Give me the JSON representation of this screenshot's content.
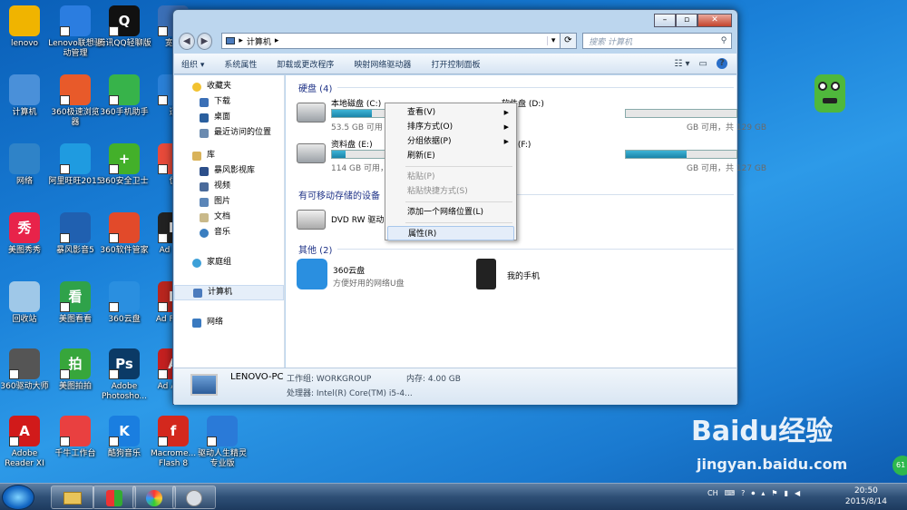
{
  "desktop_icons": [
    {
      "label": "lenovo",
      "color": "#f0b400",
      "glyph": ""
    },
    {
      "label": "Lenovo联想驱动管理",
      "color": "#2b7de0",
      "glyph": ""
    },
    {
      "label": "腾讯QQ轻聊版",
      "color": "#111111",
      "glyph": "Q"
    },
    {
      "label": "宽带",
      "color": "#3b6fb6",
      "glyph": ""
    },
    {
      "label": "计算机",
      "color": "#4a90d9",
      "glyph": ""
    },
    {
      "label": "360极速浏览器",
      "color": "#e85a2a",
      "glyph": ""
    },
    {
      "label": "360手机助手",
      "color": "#37b34a",
      "glyph": ""
    },
    {
      "label": "迅",
      "color": "#2a7fd6",
      "glyph": ""
    },
    {
      "label": "网络",
      "color": "#2f83c8",
      "glyph": ""
    },
    {
      "label": "阿里旺旺2015",
      "color": "#1f9be0",
      "glyph": ""
    },
    {
      "label": "360安全卫士",
      "color": "#43b02a",
      "glyph": "+"
    },
    {
      "label": "优",
      "color": "#e84a3a",
      "glyph": ""
    },
    {
      "label": "美图秀秀",
      "color": "#e8234a",
      "glyph": "秀"
    },
    {
      "label": "暴风影音5",
      "color": "#2060b0",
      "glyph": ""
    },
    {
      "label": "360软件管家",
      "color": "#e24a2a",
      "glyph": ""
    },
    {
      "label": "Ad Fire",
      "color": "#222222",
      "glyph": "F"
    },
    {
      "label": "回收站",
      "color": "#9fc8e8",
      "glyph": ""
    },
    {
      "label": "美图看看",
      "color": "#2fa24a",
      "glyph": "看"
    },
    {
      "label": "360云盘",
      "color": "#2a8fe0",
      "glyph": ""
    },
    {
      "label": "Ad Flash",
      "color": "#b8261e",
      "glyph": "F"
    },
    {
      "label": "360驱动大师",
      "color": "#555555",
      "glyph": ""
    },
    {
      "label": "美图拍拍",
      "color": "#37a63b",
      "glyph": "拍"
    },
    {
      "label": "Adobe Photosho...",
      "color": "#0b3a66",
      "glyph": "Ps"
    },
    {
      "label": "Ad Appl",
      "color": "#c42020",
      "glyph": "A"
    },
    {
      "label": "Adobe Reader XI",
      "color": "#d11a1a",
      "glyph": "A"
    },
    {
      "label": "千牛工作台",
      "color": "#e94040",
      "glyph": ""
    },
    {
      "label": "酷狗音乐",
      "color": "#1a7ee0",
      "glyph": "K"
    },
    {
      "label": "Macrome... Flash 8",
      "color": "#d3281d",
      "glyph": "f"
    },
    {
      "label": "驱动人生精灵 专业版",
      "color": "#2a7ad8",
      "glyph": ""
    }
  ],
  "window": {
    "breadcrumb": "计算机",
    "search_placeholder": "搜索 计算机",
    "toolbar": [
      "组织 ▾",
      "系统属性",
      "卸载或更改程序",
      "映射网络驱动器",
      "打开控制面板"
    ],
    "nav": {
      "favorites": "收藏夹",
      "fav_items": [
        "下载",
        "桌面",
        "最近访问的位置"
      ],
      "libraries": "库",
      "lib_items": [
        "暴风影视库",
        "视频",
        "图片",
        "文档",
        "音乐"
      ],
      "homegroup": "家庭组",
      "computer": "计算机",
      "network": "网络"
    },
    "sections": {
      "hdd": "硬盘 (4)",
      "removable": "有可移动存储的设备",
      "other": "其他 (2)"
    },
    "drives": [
      {
        "name": "本地磁盘 (C:)",
        "info": "53.5 GB 可用",
        "fill": 0.3
      },
      {
        "name": "软件盘 (D:)",
        "info": "GB 可用，共 129 GB",
        "fill": 0.0
      },
      {
        "name": "资料盘 (E:)",
        "info": "114 GB 可用，",
        "fill": 0.1
      },
      {
        "name": "盘 (F:)",
        "info": "GB 可用，共 127 GB",
        "fill": 0.55
      }
    ],
    "dvd": "DVD RW 驱动",
    "others": [
      {
        "name": "360云盘",
        "desc": "方便好用的网络U盘"
      },
      {
        "name": "我的手机",
        "desc": ""
      }
    ],
    "details": {
      "pc_name": "LENOVO-PC",
      "workgroup": "工作组: WORKGROUP",
      "memory": "内存: 4.00 GB",
      "cpu": "处理器: Intel(R) Core(TM) i5-4..."
    }
  },
  "context_menu": [
    {
      "label": "查看(V)",
      "submenu": true,
      "disabled": false
    },
    {
      "label": "排序方式(O)",
      "submenu": true,
      "disabled": false
    },
    {
      "label": "分组依据(P)",
      "submenu": true,
      "disabled": false
    },
    {
      "label": "刷新(E)",
      "submenu": false,
      "disabled": false
    },
    {
      "label": "粘贴(P)",
      "submenu": false,
      "disabled": true
    },
    {
      "label": "粘贴快捷方式(S)",
      "submenu": false,
      "disabled": true
    },
    {
      "label": "添加一个网络位置(L)",
      "submenu": false,
      "disabled": false
    },
    {
      "label": "属性(R)",
      "submenu": false,
      "disabled": false
    }
  ],
  "taskbar": {
    "ime": "CH",
    "time": "20:50",
    "date": "2015/8/14",
    "badge": "61"
  },
  "watermark": {
    "brand": "Baidu经验",
    "url": "jingyan.baidu.com"
  }
}
